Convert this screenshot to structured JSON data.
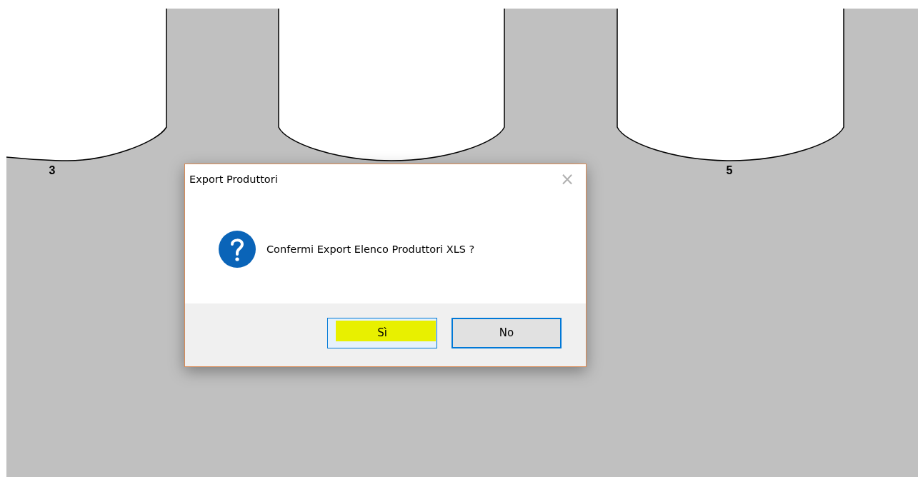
{
  "diagram": {
    "tanks": [
      {
        "kind": "tank",
        "label": "3"
      },
      {
        "kind": "tank"
      },
      {
        "kind": "tank",
        "label": "5"
      }
    ]
  },
  "dialog": {
    "title": "Export Produttori",
    "close": "×",
    "message": "Confermi Export Elenco Produttori XLS ?",
    "buttons": [
      {
        "label": "Sì",
        "focused": false,
        "highlighted": true
      },
      {
        "label": "No",
        "focused": true,
        "highlighted": false
      }
    ]
  }
}
